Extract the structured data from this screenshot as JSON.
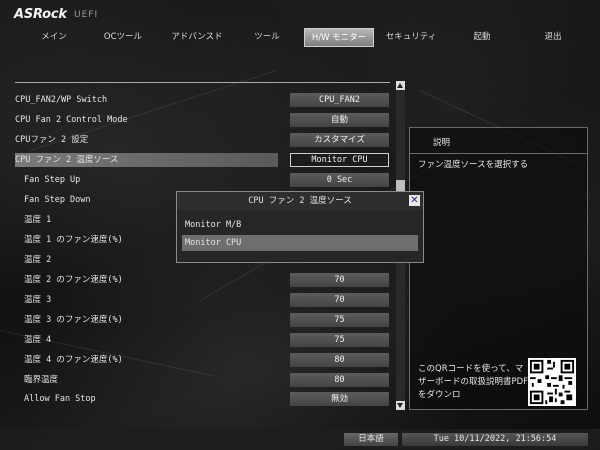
{
  "header": {
    "brand": "ASRock",
    "firmware": "UEFI"
  },
  "tabs": [
    {
      "label": "メイン"
    },
    {
      "label": "OCツール"
    },
    {
      "label": "アドバンスド"
    },
    {
      "label": "ツール"
    },
    {
      "label": "H/W モニター",
      "active": true
    },
    {
      "label": "セキュリティ"
    },
    {
      "label": "起動"
    },
    {
      "label": "退出"
    }
  ],
  "settings": [
    {
      "label": "CPU_FAN2/WP Switch",
      "value": "CPU_FAN2",
      "indent": false
    },
    {
      "label": "CPU Fan 2 Control Mode",
      "value": "自動",
      "indent": false
    },
    {
      "label": "CPUファン 2 設定",
      "value": "カスタマイズ",
      "indent": false
    },
    {
      "label": "CPU ファン 2 温度ソース",
      "value": "Monitor CPU",
      "indent": false,
      "selected": true
    },
    {
      "label": "Fan Step Up",
      "value": "0 Sec",
      "indent": true
    },
    {
      "label": "Fan Step Down",
      "value": "",
      "indent": true
    },
    {
      "label": "温度 1",
      "value": "",
      "indent": true
    },
    {
      "label": "温度 1 のファン速度(%)",
      "value": "",
      "indent": true
    },
    {
      "label": "温度 2",
      "value": "",
      "indent": true
    },
    {
      "label": "温度 2 のファン速度(%)",
      "value": "70",
      "indent": true
    },
    {
      "label": "温度 3",
      "value": "70",
      "indent": true
    },
    {
      "label": "温度 3 のファン速度(%)",
      "value": "75",
      "indent": true
    },
    {
      "label": "温度 4",
      "value": "75",
      "indent": true
    },
    {
      "label": "温度 4 のファン速度(%)",
      "value": "80",
      "indent": true
    },
    {
      "label": "臨界温度",
      "value": "80",
      "indent": true
    },
    {
      "label": "Allow Fan Stop",
      "value": "無効",
      "indent": true
    }
  ],
  "help": {
    "title": "説明",
    "description": "ファン温度ソースを選択する",
    "qr_text": "このQRコードを使って、マザーボードの取扱説明書PDFをダウンロ"
  },
  "popup": {
    "title": "CPU ファン 2 温度ソース",
    "options": [
      {
        "label": "Monitor M/B"
      },
      {
        "label": "Monitor CPU",
        "selected": true
      }
    ],
    "close_icon": "close-icon"
  },
  "footer": {
    "language": "日本語",
    "datetime": "Tue 10/11/2022, 21:56:54"
  },
  "colors": {
    "accent_tab": "#9a9a9a",
    "selected_row": "#6e6e6e",
    "close_glyph": "#1b2c88"
  }
}
